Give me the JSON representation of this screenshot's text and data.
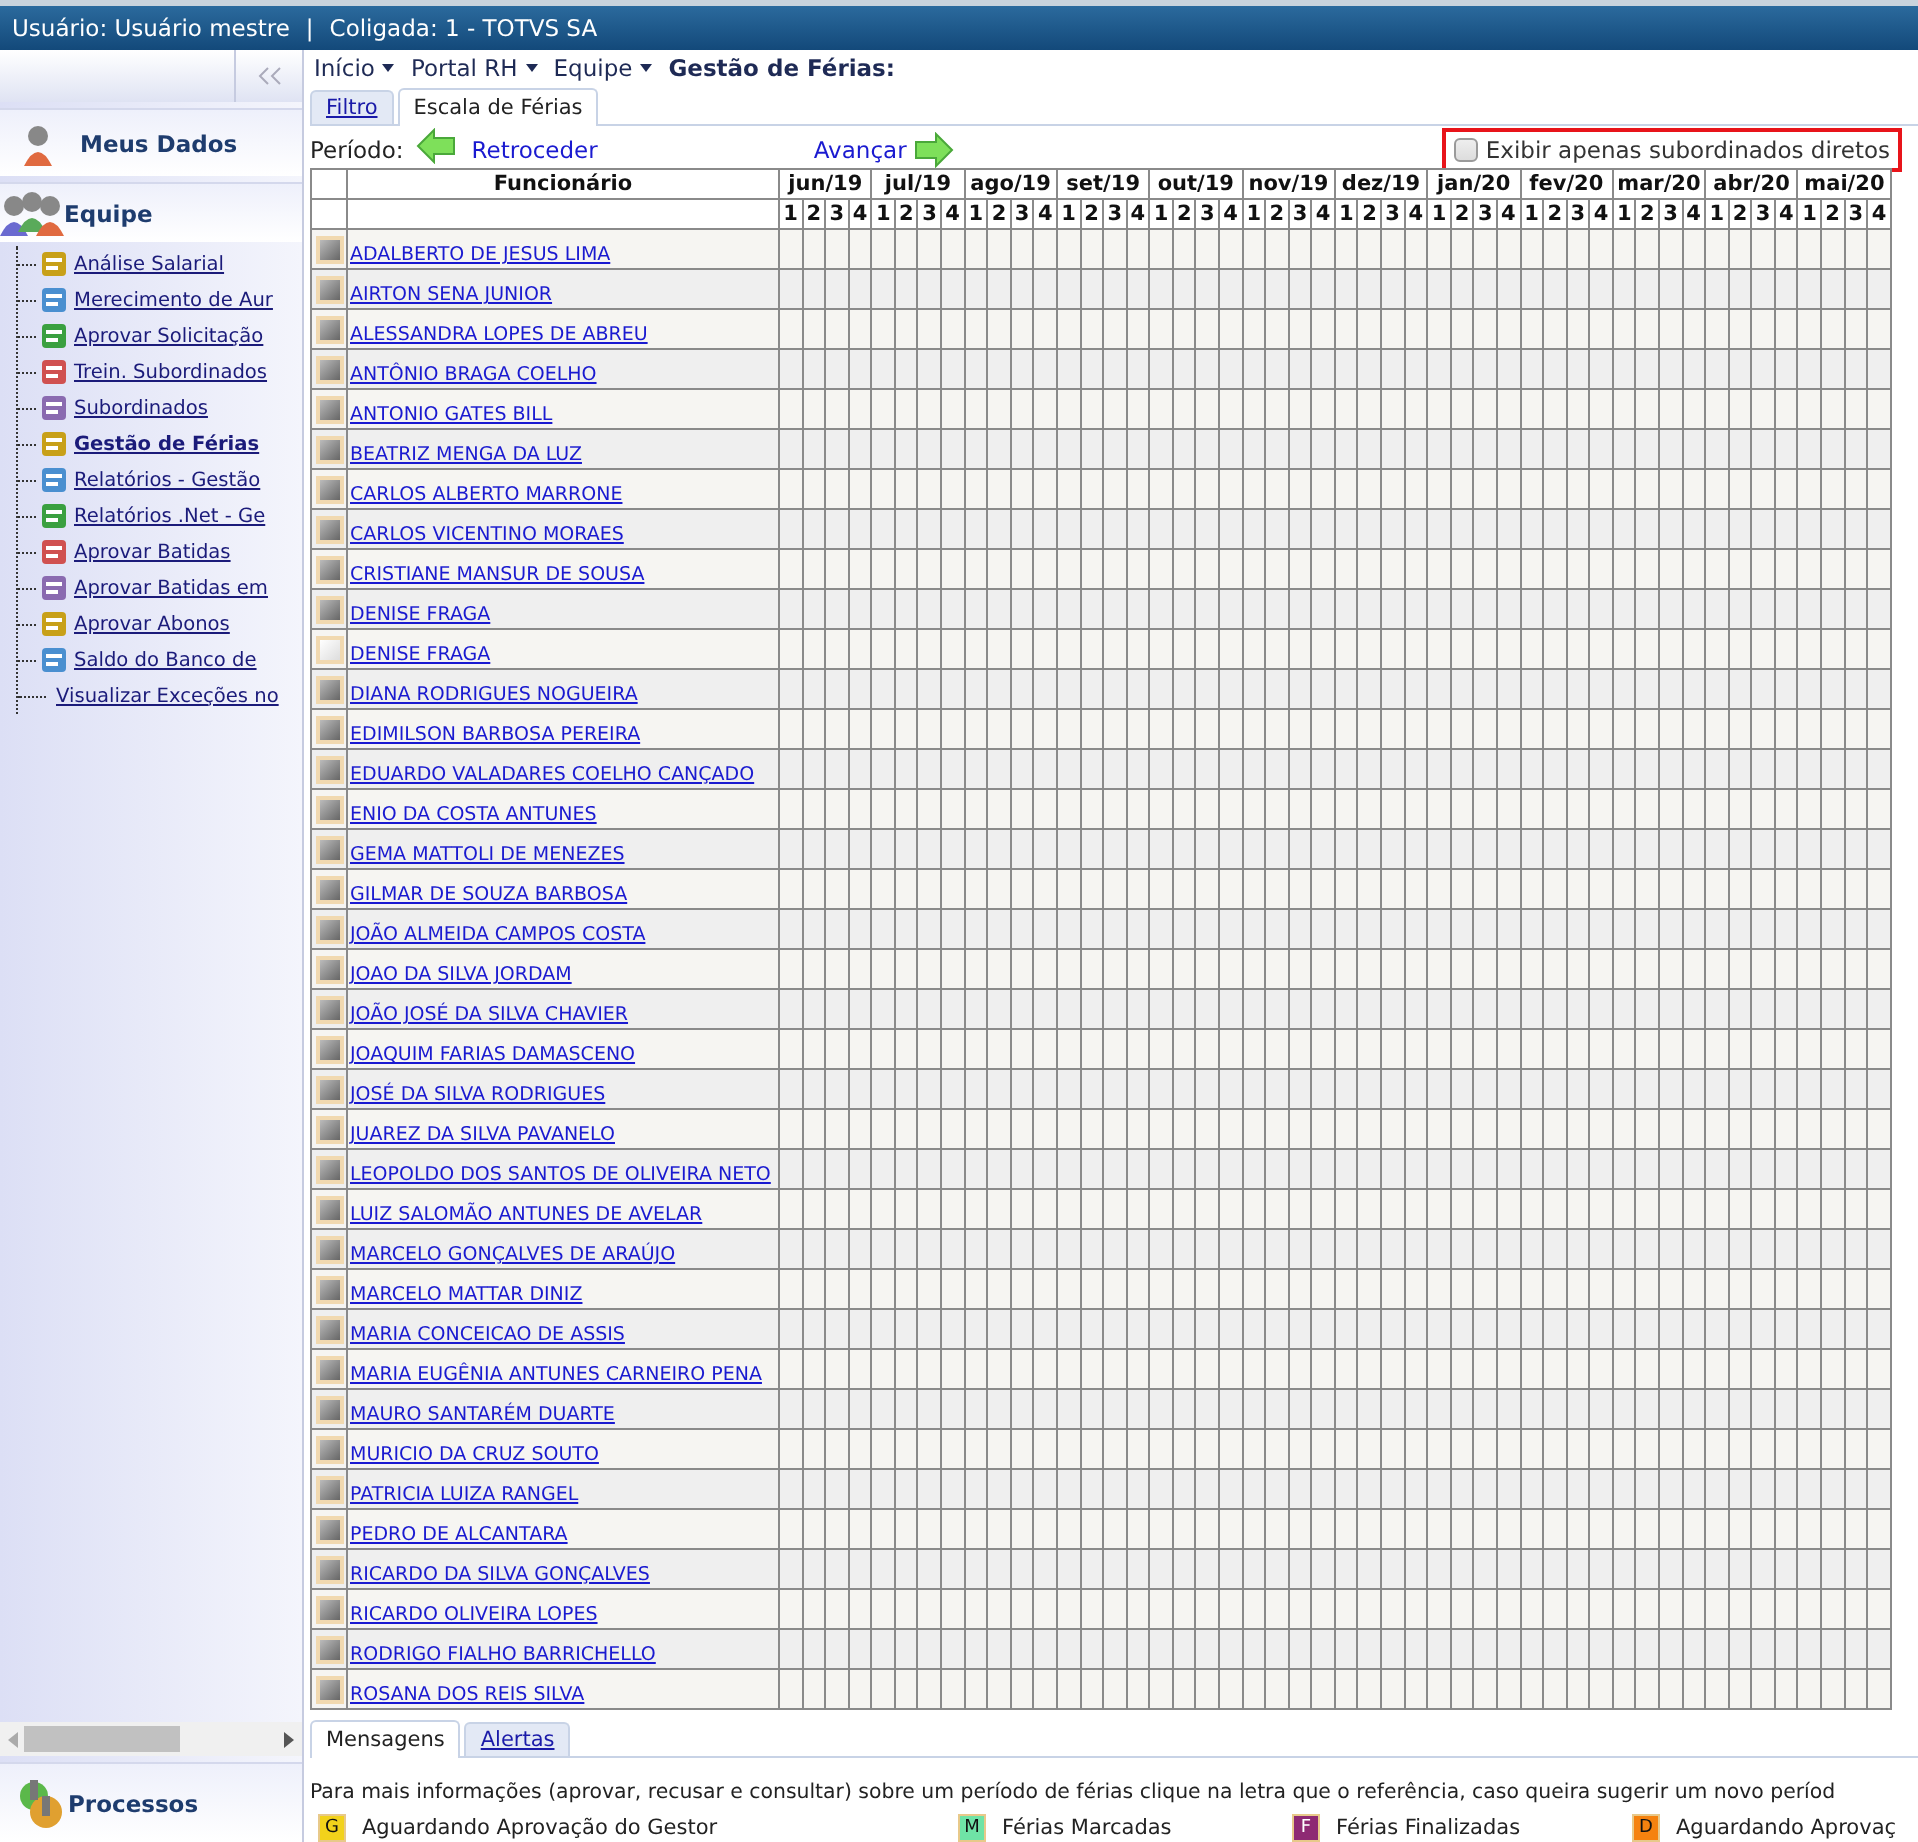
{
  "top_bar": {
    "user": "Usuário: Usuário mestre",
    "separator": "|",
    "company": "Coligada: 1 - TOTVS SA"
  },
  "sidebar": {
    "sections": [
      {
        "title": "Meus Dados",
        "kind": "person"
      },
      {
        "title": "Equipe",
        "kind": "team",
        "items": [
          {
            "label": "Análise Salarial",
            "selected": false,
            "kind": "icon"
          },
          {
            "label": "Merecimento de Aur",
            "selected": false,
            "kind": "icon"
          },
          {
            "label": "Aprovar Solicitação",
            "selected": false,
            "kind": "icon"
          },
          {
            "label": "Trein. Subordinados",
            "selected": false,
            "kind": "icon"
          },
          {
            "label": "Subordinados",
            "selected": false,
            "kind": "icon"
          },
          {
            "label": "Gestão de Férias",
            "selected": true,
            "kind": "icon"
          },
          {
            "label": "Relatórios - Gestão",
            "selected": false,
            "kind": "icon"
          },
          {
            "label": "Relatórios .Net - Ge",
            "selected": false,
            "kind": "icon"
          },
          {
            "label": "Aprovar Batidas",
            "selected": false,
            "kind": "icon"
          },
          {
            "label": "Aprovar Batidas em",
            "selected": false,
            "kind": "icon"
          },
          {
            "label": "Aprovar Abonos",
            "selected": false,
            "kind": "icon"
          },
          {
            "label": "Saldo do Banco de",
            "selected": false,
            "kind": "icon"
          },
          {
            "label": "Visualizar Exceções no",
            "selected": false,
            "kind": "plain"
          }
        ]
      }
    ],
    "footer_section": {
      "title": "Processos"
    }
  },
  "breadcrumbs": [
    {
      "label": "Início",
      "kind": "menu"
    },
    {
      "label": "Portal RH",
      "kind": "menu"
    },
    {
      "label": "Equipe",
      "kind": "menu"
    },
    {
      "label": "Gestão de Férias:",
      "kind": "current"
    }
  ],
  "tabs": [
    {
      "label": "Filtro",
      "selected": false
    },
    {
      "label": "Escala de Férias",
      "selected": true
    }
  ],
  "period": {
    "label": "Período:",
    "back": "Retroceder",
    "forward": "Avançar"
  },
  "filter": {
    "label": "Exibir apenas subordinados diretos",
    "checked": false
  },
  "table": {
    "employee_header": "Funcionário",
    "months": [
      {
        "label": "jun/19",
        "weeks": [
          "1",
          "2",
          "3",
          "4"
        ]
      },
      {
        "label": "jul/19",
        "weeks": [
          "1",
          "2",
          "3",
          "4"
        ]
      },
      {
        "label": "ago/19",
        "weeks": [
          "1",
          "2",
          "3",
          "4"
        ]
      },
      {
        "label": "set/19",
        "weeks": [
          "1",
          "2",
          "3",
          "4"
        ]
      },
      {
        "label": "out/19",
        "weeks": [
          "1",
          "2",
          "3",
          "4"
        ]
      },
      {
        "label": "nov/19",
        "weeks": [
          "1",
          "2",
          "3",
          "4"
        ]
      },
      {
        "label": "dez/19",
        "weeks": [
          "1",
          "2",
          "3",
          "4"
        ]
      },
      {
        "label": "jan/20",
        "weeks": [
          "1",
          "2",
          "3",
          "4"
        ]
      },
      {
        "label": "fev/20",
        "weeks": [
          "1",
          "2",
          "3",
          "4"
        ]
      },
      {
        "label": "mar/20",
        "weeks": [
          "1",
          "2",
          "3",
          "4"
        ]
      },
      {
        "label": "abr/20",
        "weeks": [
          "1",
          "2",
          "3",
          "4"
        ]
      },
      {
        "label": "mai/20",
        "weeks": [
          "1",
          "2",
          "3",
          "4"
        ]
      }
    ],
    "rows": [
      {
        "name": "ADALBERTO DE JESUS LIMA",
        "kind": "dark"
      },
      {
        "name": "AIRTON SENA JUNIOR",
        "kind": "dark"
      },
      {
        "name": "ALESSANDRA LOPES DE ABREU",
        "kind": "dark"
      },
      {
        "name": "ANTÔNIO BRAGA COELHO",
        "kind": "dark"
      },
      {
        "name": "ANTONIO GATES BILL",
        "kind": "dark"
      },
      {
        "name": "BEATRIZ MENGA DA LUZ",
        "kind": "dark"
      },
      {
        "name": "CARLOS ALBERTO MARRONE",
        "kind": "dark"
      },
      {
        "name": "CARLOS VICENTINO MORAES",
        "kind": "dark"
      },
      {
        "name": "CRISTIANE MANSUR DE SOUSA",
        "kind": "dark"
      },
      {
        "name": "DENISE FRAGA",
        "kind": "dark"
      },
      {
        "name": "DENISE FRAGA",
        "kind": "light"
      },
      {
        "name": "DIANA RODRIGUES NOGUEIRA",
        "kind": "dark"
      },
      {
        "name": "EDIMILSON BARBOSA PEREIRA",
        "kind": "dark"
      },
      {
        "name": "EDUARDO VALADARES COELHO CANÇADO",
        "kind": "dark"
      },
      {
        "name": "ENIO DA COSTA ANTUNES",
        "kind": "dark"
      },
      {
        "name": "GEMA MATTOLI DE MENEZES",
        "kind": "dark"
      },
      {
        "name": "GILMAR DE SOUZA BARBOSA",
        "kind": "dark"
      },
      {
        "name": "JOÃO ALMEIDA CAMPOS COSTA",
        "kind": "dark"
      },
      {
        "name": "JOAO DA SILVA JORDAM",
        "kind": "dark"
      },
      {
        "name": "JOÃO JOSÉ DA SILVA CHAVIER",
        "kind": "dark"
      },
      {
        "name": "JOAQUIM FARIAS DAMASCENO",
        "kind": "dark"
      },
      {
        "name": "JOSÉ DA SILVA RODRIGUES",
        "kind": "dark"
      },
      {
        "name": "JUAREZ DA SILVA PAVANELO",
        "kind": "dark"
      },
      {
        "name": "LEOPOLDO DOS SANTOS DE OLIVEIRA NETO",
        "kind": "dark"
      },
      {
        "name": "LUIZ SALOMÃO ANTUNES DE AVELAR",
        "kind": "dark"
      },
      {
        "name": "MARCELO GONÇALVES DE ARAÚJO",
        "kind": "dark"
      },
      {
        "name": "MARCELO MATTAR DINIZ",
        "kind": "dark"
      },
      {
        "name": "MARIA CONCEICAO DE ASSIS",
        "kind": "dark"
      },
      {
        "name": "MARIA EUGÊNIA ANTUNES CARNEIRO PENA",
        "kind": "dark"
      },
      {
        "name": "MAURO SANTARÉM DUARTE",
        "kind": "dark"
      },
      {
        "name": "MURICIO DA CRUZ SOUTO",
        "kind": "dark"
      },
      {
        "name": "PATRICIA LUIZA RANGEL",
        "kind": "dark"
      },
      {
        "name": "PEDRO DE ALCANTARA",
        "kind": "dark"
      },
      {
        "name": "RICARDO DA SILVA GONÇALVES",
        "kind": "dark"
      },
      {
        "name": "RICARDO OLIVEIRA LOPES",
        "kind": "dark"
      },
      {
        "name": "RODRIGO FIALHO BARRICHELLO",
        "kind": "dark"
      },
      {
        "name": "ROSANA DOS REIS SILVA",
        "kind": "dark"
      }
    ]
  },
  "bottom_tabs": [
    {
      "label": "Mensagens",
      "selected": true
    },
    {
      "label": "Alertas",
      "selected": false
    }
  ],
  "message": "Para mais informações (aprovar, recusar e consultar) sobre um período de férias clique na letra que o referência, caso queira sugerir um novo períod",
  "legend": [
    {
      "letter": "G",
      "label": "Aguardando Aprovação do Gestor",
      "color": "#f2d21b"
    },
    {
      "letter": "M",
      "label": "Férias Marcadas",
      "color": "#6fe3a6"
    },
    {
      "letter": "F",
      "label": "Férias Finalizadas",
      "color": "#8e2a73"
    },
    {
      "letter": "D",
      "label": "Aguardando Aprovaç",
      "color": "#f5820f"
    }
  ]
}
